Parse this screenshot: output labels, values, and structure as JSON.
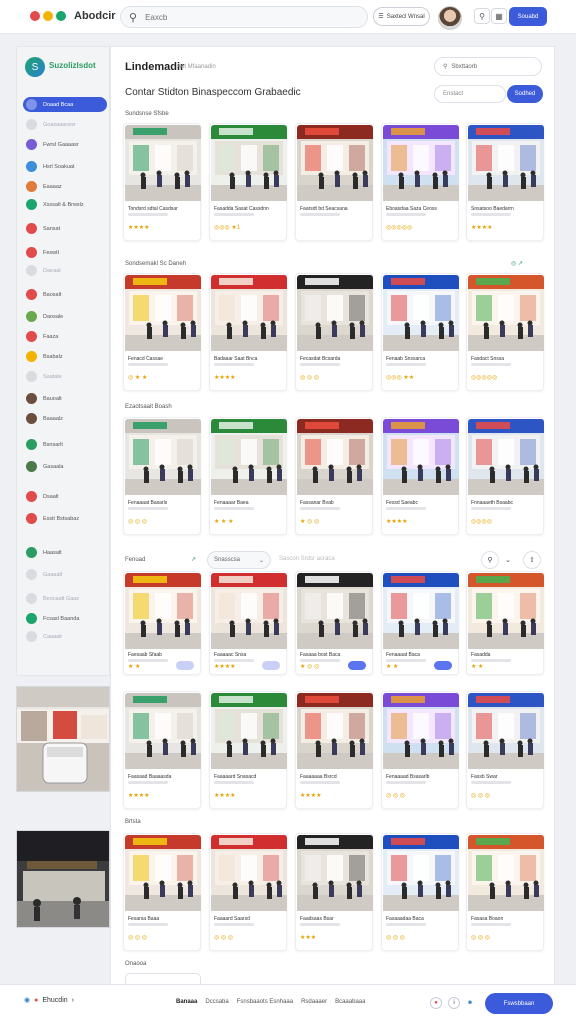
{
  "app": {
    "brand": "Abodcir",
    "dot_colors": [
      "#e24b4b",
      "#f2b400",
      "#1aa56a"
    ]
  },
  "topbar": {
    "search_placeholder": "Eaxcb",
    "filter_label": "Saxtecl Wnsal",
    "primary_label": "Souabd",
    "icons": [
      "search-icon",
      "chat-icon",
      "grid-icon"
    ]
  },
  "sidebar": {
    "logo": "S",
    "title": "Suzolizlsdot",
    "items": [
      {
        "label": "Doaad Bcaa",
        "color": "#3b5bdb",
        "active": true
      },
      {
        "label": "Goazaaacesr",
        "color": "#d9dbe0",
        "faded": true
      },
      {
        "label": "Fwrsl Gaaaasr",
        "color": "#7a5bd6"
      },
      {
        "label": "Hsrl Soakuat",
        "color": "#3b8fdb"
      },
      {
        "label": "Eaaaaz",
        "color": "#e07b39"
      },
      {
        "label": "Xsssalt & Brwslz",
        "color": "#1aa56a"
      },
      {
        "label": "Sansat",
        "color": "#e24b4b"
      },
      {
        "label": "Feswtl",
        "color": "#e24b4b"
      },
      {
        "label": "Daeaat",
        "color": "#d9dbe0",
        "faded": true
      },
      {
        "label": "Baosalt",
        "color": "#e24b4b"
      },
      {
        "label": "Daosale",
        "color": "#6aa84f"
      },
      {
        "label": "Faaza",
        "color": "#e24b4b"
      },
      {
        "label": "Bsabalz",
        "color": "#f2b400"
      },
      {
        "label": "Saatale",
        "color": "#d9dbe0",
        "faded": true
      },
      {
        "label": "Bauoalt",
        "color": "#6b4e3d"
      },
      {
        "label": "Baaaalz",
        "color": "#6b4e3d"
      },
      {
        "label": "Bsnsarlt",
        "color": "#2a9d63"
      },
      {
        "label": "Gasaala",
        "color": "#4a7a4a"
      },
      {
        "label": "Dsaalt",
        "color": "#e24b4b"
      },
      {
        "label": "Essit Bstsabaz",
        "color": "#e24b4b"
      },
      {
        "label": "Haasalt",
        "color": "#2a9d63"
      },
      {
        "label": "Gaaaalt",
        "color": "#d9dbe0",
        "faded": true
      },
      {
        "label": "Beocaalt Gaaz",
        "color": "#d9dbe0",
        "faded": true
      },
      {
        "label": "Fcsasl Baanda",
        "color": "#1aa56a"
      },
      {
        "label": "Caaaalr",
        "color": "#d9dbe0",
        "faded": true
      }
    ]
  },
  "main": {
    "title": "Lindemadir",
    "title_sub": "Aot Mfaanadin",
    "subtitle": "Contar Stidton Binaspeccom Grabaedic",
    "search_placeholder": "Sbxttaorb",
    "filter_placeholder": "Enstact",
    "filter_button": "Sodhed",
    "sections": [
      "Sundsnse Sfsbe",
      "Sondsemakl Sc Daneh",
      "Ezaotsaait Boash",
      "Fenuad",
      "Brtsta",
      "Onaooa"
    ],
    "toolbar": {
      "dropdown": "Snasscsa",
      "ghost": "Sascon Srdsr acraca"
    }
  },
  "cards": [
    {
      "name": "Tondsrd sdtal Casdsar",
      "rating": "★★★★",
      "score": "4",
      "btn": ""
    },
    {
      "name": "Fasadda Sasat Cassdnn",
      "rating": "◎◎◎ ★1",
      "score": "",
      "btn": ""
    },
    {
      "name": "Faarsdt bd Seacsana",
      "rating": "",
      "score": "",
      "btn": ""
    },
    {
      "name": "Eboasdaa Saza Ceoss",
      "rating": "◎◎◎◎◎",
      "score": "",
      "btn": ""
    },
    {
      "name": "Snsatsoo Baedarrn",
      "rating": "★★★★",
      "score": "",
      "btn": ""
    },
    {
      "name": "Fenacd Cassae",
      "rating": "◎ ★ ★",
      "score": "",
      "btn": ""
    },
    {
      "name": "Badaaar Saat Bnca",
      "rating": "★★★★",
      "score": "",
      "btn": ""
    },
    {
      "name": "Fecasdat Bcsarda",
      "rating": "◎ ◎ ◎",
      "score": "",
      "btn": ""
    },
    {
      "name": "Fenaab Snssarca",
      "rating": "◎◎◎ ★★",
      "score": "",
      "btn": ""
    },
    {
      "name": "Fasdact Snssa",
      "rating": "◎◎◎◎◎",
      "score": "",
      "btn": ""
    },
    {
      "name": "Fenaaaat Basarls",
      "rating": "◎ ◎ ◎",
      "score": "",
      "btn": ""
    },
    {
      "name": "Fenaaaar Baea",
      "rating": "★ ★ ★",
      "score": "",
      "btn": ""
    },
    {
      "name": "Fassanar Bvab",
      "rating": "★ ◎ ◎",
      "score": "",
      "btn": ""
    },
    {
      "name": "Fessd Saeabc",
      "rating": "★★★★",
      "score": "",
      "btn": ""
    },
    {
      "name": "Fnnaaaeth Bsaabc",
      "rating": "◎◎◎◎",
      "score": "",
      "btn": ""
    },
    {
      "name": "Faesaab Sfaab",
      "rating": "★ ★",
      "score": "",
      "btn": "light"
    },
    {
      "name": "Faaaaac Snsa",
      "rating": "★★★★",
      "score": "",
      "btn": "light"
    },
    {
      "name": "Fasaaa bost Baca",
      "rating": "★ ◎ ◎",
      "score": "",
      "btn": "dark"
    },
    {
      "name": "Fenaaaat Baca",
      "rating": "★ ★",
      "score": "",
      "btn": "dark"
    },
    {
      "name": "Fasadda",
      "rating": "★ ★",
      "score": "",
      "btn": ""
    },
    {
      "name": "Faasaad Baaaasda",
      "rating": "★★★★",
      "score": "",
      "btn": ""
    },
    {
      "name": "Faaaaard Snasacd",
      "rating": "★★★★",
      "score": "",
      "btn": ""
    },
    {
      "name": "Faaaaaaa Bsrcd",
      "rating": "★★★★",
      "score": "",
      "btn": ""
    },
    {
      "name": "Fenaaaad Bsasarlb",
      "rating": "◎ ◎ ◎",
      "score": "",
      "btn": ""
    },
    {
      "name": "Fassb Swar",
      "rating": "◎ ◎ ◎",
      "score": "",
      "btn": ""
    },
    {
      "name": "Fesarsa Baaa",
      "rating": "◎ ◎ ◎",
      "score": "",
      "btn": ""
    },
    {
      "name": "Faaaard Saarsd",
      "rating": "◎ ◎ ◎",
      "score": "",
      "btn": ""
    },
    {
      "name": "Faadsaas Bsar",
      "rating": "★★★",
      "score": "",
      "btn": ""
    },
    {
      "name": "Fasaaadaa Baca",
      "rating": "◎ ◎ ◎",
      "score": "",
      "btn": ""
    },
    {
      "name": "Fasasa Boaon",
      "rating": "◎ ◎ ◎",
      "score": "",
      "btn": ""
    }
  ],
  "bottombar": {
    "left_label": "Ehucdin",
    "links": [
      "Banaaa",
      "Dccsaba",
      "Fsnsbaaots Esnhaaa",
      "Rsdaaaer",
      "Bcaaabaaa"
    ],
    "primary": "Fswsbbaan"
  }
}
